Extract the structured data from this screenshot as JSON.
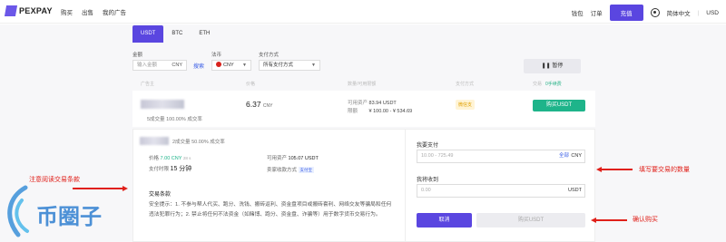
{
  "nav": {
    "logo": "PEXPAY",
    "links": [
      "购买",
      "出售",
      "我的广告"
    ],
    "wallet": "钱包",
    "orders": "订单",
    "charge": "充值",
    "language": "简体中文",
    "currency": "USD"
  },
  "tabs": [
    "USDT",
    "BTC",
    "ETH"
  ],
  "filter": {
    "amount_label": "金额",
    "amount_placeholder": "输入金额",
    "amount_unit": "CNY",
    "search": "搜索",
    "fiat_label": "法币",
    "fiat_value": "CNY",
    "pay_label": "支付方式",
    "pay_value": "所有支付方式",
    "pause": "暂停"
  },
  "table_header": {
    "advertiser": "广告主",
    "price": "价格",
    "limit": "数量/可用限额",
    "payment": "支付方式",
    "trade": "交易",
    "recommend": "0手续费"
  },
  "ad": {
    "stats": "5成交量  100.00% 成交率",
    "price": "6.37",
    "price_unit": "CNY",
    "available_label": "可用资产",
    "available": "83.94 USDT",
    "limit_label": "限额",
    "limit": "¥ 100.00 - ¥ 534.69",
    "payment": "微信支",
    "buy": "购买USDT"
  },
  "panel": {
    "stats": "2成交量  50.00% 成交率",
    "price_label": "价格",
    "price": "7.00 CNY",
    "price_time": "28 s",
    "available_label": "可用资产",
    "available": "105.07 USDT",
    "pay_time_label": "支付时限",
    "pay_time": "15 分钟",
    "seller_pay_label": "卖家收款方式",
    "seller_pay": "支付宝",
    "terms_title": "交易条款",
    "terms_text": "安全提示：1. 不参与帮人代买、跑分、洗钱、搬砖返利、资金盘项目或搬砖套利、网络交友等骗局和任何违法犯罪行为；2. 禁止将任何不法资金（如赌博、跑分、资金盘、诈骗等）用于数字货币交易行为。",
    "want_pay_label": "我要支付",
    "want_pay_placeholder": "10.00 - 725.49",
    "want_pay_all": "全部",
    "want_pay_unit": "CNY",
    "will_receive_label": "我将收到",
    "will_receive_placeholder": "0.00",
    "will_receive_unit": "USDT",
    "cancel": "取消",
    "buy": "购买USDT"
  },
  "annotations": {
    "left": "注意阅读交易条款",
    "fill": "填写要交易的数量",
    "confirm": "确认购买"
  },
  "watermark": "币圈子",
  "colors": {
    "accent": "#5a46e0",
    "buy": "#1eb48a",
    "annotation": "#e0201a"
  }
}
